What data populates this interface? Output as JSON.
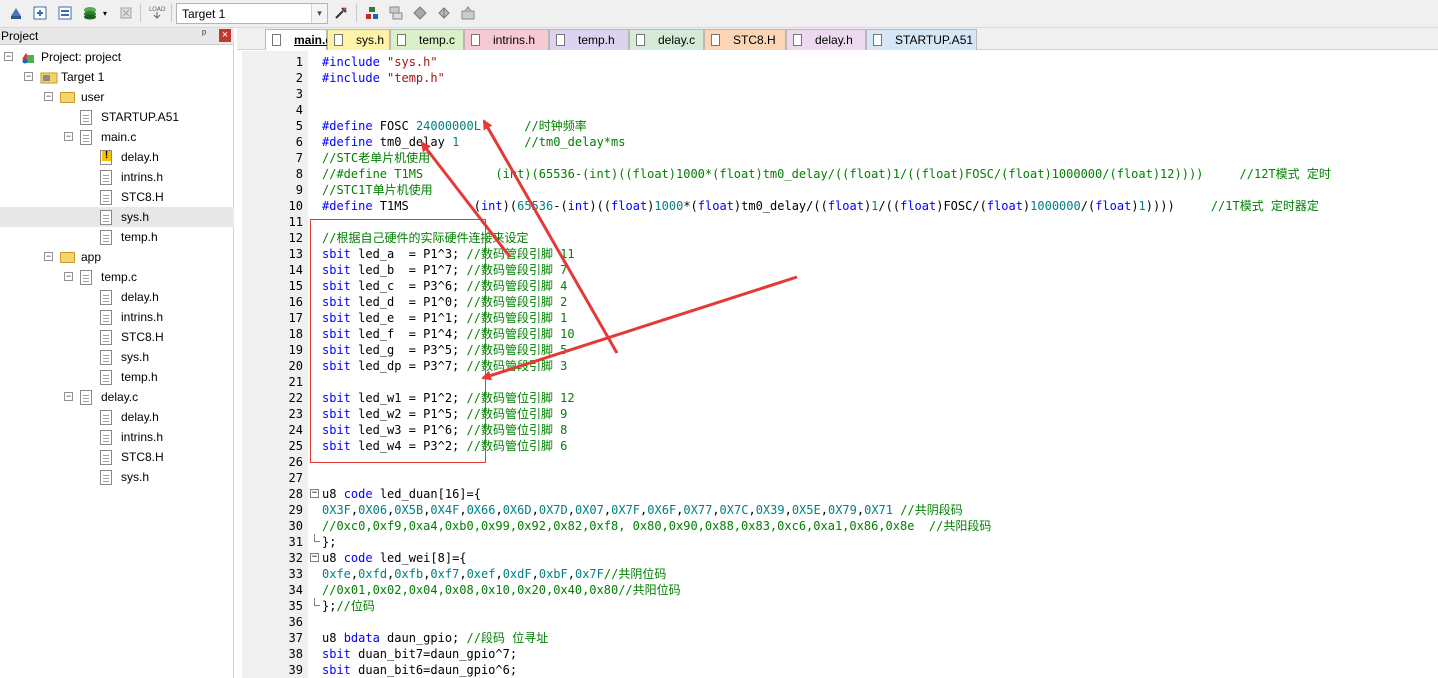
{
  "toolbar": {
    "target_value": "Target 1",
    "icons": [
      "translate-icon",
      "build-icon",
      "rebuild-icon",
      "batch-build-icon",
      "stop-build-icon",
      "download-icon",
      "target-options-icon",
      "manage-components-icon",
      "file-extensions-icon",
      "select-pack-icon",
      "pack-installer-icon",
      "load-icon"
    ]
  },
  "project_panel": {
    "title": "Project",
    "pin": "ᵖ",
    "close": "×",
    "tree": [
      {
        "label": "Project: project",
        "icon": "project-icon",
        "level": 0
      },
      {
        "label": "Target 1",
        "icon": "target-icon",
        "level": 1
      },
      {
        "label": "user",
        "icon": "folder-icon",
        "level": 2
      },
      {
        "label": "STARTUP.A51",
        "icon": "file-icon",
        "level": 3
      },
      {
        "label": "main.c",
        "icon": "file-icon",
        "level": 3
      },
      {
        "label": "delay.h",
        "icon": "warning-file-icon",
        "level": 4
      },
      {
        "label": "intrins.h",
        "icon": "file-icon",
        "level": 4
      },
      {
        "label": "STC8.H",
        "icon": "file-icon",
        "level": 4
      },
      {
        "label": "sys.h",
        "icon": "file-icon",
        "level": 4,
        "selected": true
      },
      {
        "label": "temp.h",
        "icon": "file-icon",
        "level": 4
      },
      {
        "label": "app",
        "icon": "folder-icon",
        "level": 2
      },
      {
        "label": "temp.c",
        "icon": "file-icon",
        "level": 3
      },
      {
        "label": "delay.h",
        "icon": "file-icon",
        "level": 4
      },
      {
        "label": "intrins.h",
        "icon": "file-icon",
        "level": 4
      },
      {
        "label": "STC8.H",
        "icon": "file-icon",
        "level": 4
      },
      {
        "label": "sys.h",
        "icon": "file-icon",
        "level": 4
      },
      {
        "label": "temp.h",
        "icon": "file-icon",
        "level": 4
      },
      {
        "label": "delay.c",
        "icon": "file-icon",
        "level": 3
      },
      {
        "label": "delay.h",
        "icon": "file-icon",
        "level": 4
      },
      {
        "label": "intrins.h",
        "icon": "file-icon",
        "level": 4
      },
      {
        "label": "STC8.H",
        "icon": "file-icon",
        "level": 4
      },
      {
        "label": "sys.h",
        "icon": "file-icon",
        "level": 4
      }
    ]
  },
  "tabs": [
    {
      "label": "main.c",
      "color": "#ffffff",
      "active": true
    },
    {
      "label": "sys.h",
      "color": "#fff3a8"
    },
    {
      "label": "temp.c",
      "color": "#d9f0c8"
    },
    {
      "label": "intrins.h",
      "color": "#f7c9d2"
    },
    {
      "label": "temp.h",
      "color": "#ddd3f0"
    },
    {
      "label": "delay.c",
      "color": "#d6ead8"
    },
    {
      "label": "STC8.H",
      "color": "#fbd5b4"
    },
    {
      "label": "delay.h",
      "color": "#ecd9ef"
    },
    {
      "label": "STARTUP.A51",
      "color": "#d6e6f5"
    }
  ],
  "editor": {
    "lines": [
      {
        "n": "1",
        "text": "#include \"sys.h\""
      },
      {
        "n": "2",
        "text": "#include \"temp.h\""
      },
      {
        "n": "3",
        "text": ""
      },
      {
        "n": "4",
        "text": ""
      },
      {
        "n": "5",
        "text": "#define FOSC 24000000L      //时钟频率"
      },
      {
        "n": "6",
        "text": "#define tm0_delay 1         //tm0_delay*ms"
      },
      {
        "n": "7",
        "text": "//STC老单片机使用"
      },
      {
        "n": "8",
        "text": "//#define T1MS          (int)(65536-(int)((float)1000*(float)tm0_delay/((float)1/((float)FOSC/(float)1000000/(float)12))))     //12T模式 定时"
      },
      {
        "n": "9",
        "text": "//STC1T单片机使用"
      },
      {
        "n": "10",
        "text": "#define T1MS         (int)(65536-(int)((float)1000*(float)tm0_delay/((float)1/((float)FOSC/(float)1000000/(float)1))))     //1T模式 定时器定"
      },
      {
        "n": "11",
        "text": ""
      },
      {
        "n": "12",
        "text": "//根据自己硬件的实际硬件连接来设定"
      },
      {
        "n": "13",
        "text": "sbit led_a  = P1^3; //数码管段引脚 11"
      },
      {
        "n": "14",
        "text": "sbit led_b  = P1^7; //数码管段引脚 7"
      },
      {
        "n": "15",
        "text": "sbit led_c  = P3^6; //数码管段引脚 4"
      },
      {
        "n": "16",
        "text": "sbit led_d  = P1^0; //数码管段引脚 2"
      },
      {
        "n": "17",
        "text": "sbit led_e  = P1^1; //数码管段引脚 1"
      },
      {
        "n": "18",
        "text": "sbit led_f  = P1^4; //数码管段引脚 10"
      },
      {
        "n": "19",
        "text": "sbit led_g  = P3^5; //数码管段引脚 5"
      },
      {
        "n": "20",
        "text": "sbit led_dp = P3^7; //数码管段引脚 3"
      },
      {
        "n": "21",
        "text": ""
      },
      {
        "n": "22",
        "text": "sbit led_w1 = P1^2; //数码管位引脚 12"
      },
      {
        "n": "23",
        "text": "sbit led_w2 = P1^5; //数码管位引脚 9"
      },
      {
        "n": "24",
        "text": "sbit led_w3 = P1^6; //数码管位引脚 8"
      },
      {
        "n": "25",
        "text": "sbit led_w4 = P3^2; //数码管位引脚 6"
      },
      {
        "n": "26",
        "text": ""
      },
      {
        "n": "27",
        "text": ""
      },
      {
        "n": "28",
        "text": "u8 code led_duan[16]={",
        "fold": "open"
      },
      {
        "n": "29",
        "text": "0X3F,0X06,0X5B,0X4F,0X66,0X6D,0X7D,0X07,0X7F,0X6F,0X77,0X7C,0X39,0X5E,0X79,0X71 //共阴段码"
      },
      {
        "n": "30",
        "text": "//0xc0,0xf9,0xa4,0xb0,0x99,0x92,0x82,0xf8, 0x80,0x90,0x88,0x83,0xc6,0xa1,0x86,0x8e  //共阳段码"
      },
      {
        "n": "31",
        "text": "};",
        "fold": "end"
      },
      {
        "n": "32",
        "text": "u8 code led_wei[8]={",
        "fold": "open"
      },
      {
        "n": "33",
        "text": "0xfe,0xfd,0xfb,0xf7,0xef,0xdF,0xbF,0x7F//共阴位码"
      },
      {
        "n": "34",
        "text": "//0x01,0x02,0x04,0x08,0x10,0x20,0x40,0x80//共阳位码"
      },
      {
        "n": "35",
        "text": "};//位码",
        "fold": "end"
      },
      {
        "n": "36",
        "text": ""
      },
      {
        "n": "37",
        "text": "u8 bdata daun_gpio; //段码 位寻址"
      },
      {
        "n": "38",
        "text": "sbit duan_bit7=daun_gpio^7;"
      },
      {
        "n": "39",
        "text": "sbit duan_bit6=daun_gpio^6;"
      }
    ]
  },
  "colors": {
    "keyword": "#0000ff",
    "comment": "#008000",
    "string": "#a31515",
    "number": "#008080",
    "annotation": "#e53935"
  }
}
